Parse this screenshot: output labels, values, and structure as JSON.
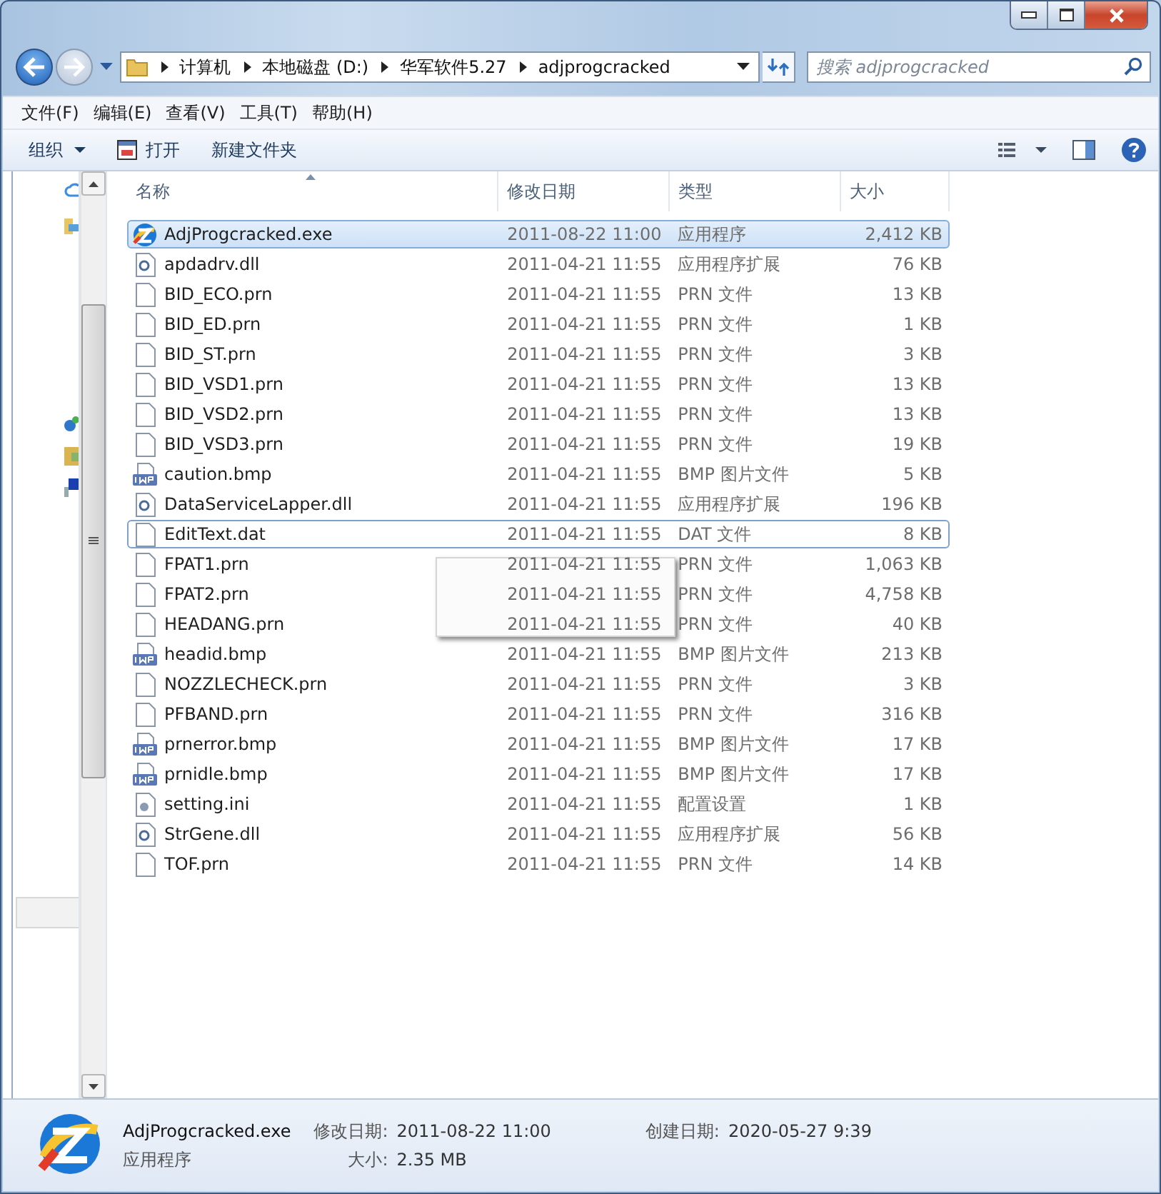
{
  "address": {
    "crumbs": [
      "计算机",
      "本地磁盘 (D:)",
      "华军软件5.27",
      "adjprogcracked"
    ]
  },
  "search": {
    "placeholder": "搜索 adjprogcracked"
  },
  "menu": [
    "文件(F)",
    "编辑(E)",
    "查看(V)",
    "工具(T)",
    "帮助(H)"
  ],
  "toolbar": [
    {
      "label": "组织",
      "kind": "dropdown"
    },
    {
      "label": "打开",
      "kind": "open"
    },
    {
      "label": "新建文件夹",
      "kind": "plain"
    }
  ],
  "columns": [
    "名称",
    "修改日期",
    "类型",
    "大小"
  ],
  "files": [
    {
      "name": "AdjProgcracked.exe",
      "date": "2011-08-22 11:00",
      "type": "应用程序",
      "size": "2,412 KB",
      "kind": "exe",
      "selected": true,
      "focused": false
    },
    {
      "name": "apdadrv.dll",
      "date": "2011-04-21 11:55",
      "type": "应用程序扩展",
      "size": "76 KB",
      "kind": "dll",
      "selected": false,
      "focused": false
    },
    {
      "name": "BID_ECO.prn",
      "date": "2011-04-21 11:55",
      "type": "PRN 文件",
      "size": "13 KB",
      "kind": "file",
      "selected": false,
      "focused": false
    },
    {
      "name": "BID_ED.prn",
      "date": "2011-04-21 11:55",
      "type": "PRN 文件",
      "size": "1 KB",
      "kind": "file",
      "selected": false,
      "focused": false
    },
    {
      "name": "BID_ST.prn",
      "date": "2011-04-21 11:55",
      "type": "PRN 文件",
      "size": "3 KB",
      "kind": "file",
      "selected": false,
      "focused": false
    },
    {
      "name": "BID_VSD1.prn",
      "date": "2011-04-21 11:55",
      "type": "PRN 文件",
      "size": "13 KB",
      "kind": "file",
      "selected": false,
      "focused": false
    },
    {
      "name": "BID_VSD2.prn",
      "date": "2011-04-21 11:55",
      "type": "PRN 文件",
      "size": "13 KB",
      "kind": "file",
      "selected": false,
      "focused": false
    },
    {
      "name": "BID_VSD3.prn",
      "date": "2011-04-21 11:55",
      "type": "PRN 文件",
      "size": "19 KB",
      "kind": "file",
      "selected": false,
      "focused": false
    },
    {
      "name": "caution.bmp",
      "date": "2011-04-21 11:55",
      "type": "BMP 图片文件",
      "size": "5 KB",
      "kind": "bmp",
      "selected": false,
      "focused": false
    },
    {
      "name": "DataServiceLapper.dll",
      "date": "2011-04-21 11:55",
      "type": "应用程序扩展",
      "size": "196 KB",
      "kind": "dll",
      "selected": false,
      "focused": false
    },
    {
      "name": "EditText.dat",
      "date": "2011-04-21 11:55",
      "type": "DAT 文件",
      "size": "8 KB",
      "kind": "file",
      "selected": false,
      "focused": true
    },
    {
      "name": "FPAT1.prn",
      "date": "2011-04-21 11:55",
      "type": "PRN 文件",
      "size": "1,063 KB",
      "kind": "file",
      "selected": false,
      "focused": false
    },
    {
      "name": "FPAT2.prn",
      "date": "2011-04-21 11:55",
      "type": "PRN 文件",
      "size": "4,758 KB",
      "kind": "file",
      "selected": false,
      "focused": false
    },
    {
      "name": "HEADANG.prn",
      "date": "2011-04-21 11:55",
      "type": "PRN 文件",
      "size": "40 KB",
      "kind": "file",
      "selected": false,
      "focused": false
    },
    {
      "name": "headid.bmp",
      "date": "2011-04-21 11:55",
      "type": "BMP 图片文件",
      "size": "213 KB",
      "kind": "bmp",
      "selected": false,
      "focused": false
    },
    {
      "name": "NOZZLECHECK.prn",
      "date": "2011-04-21 11:55",
      "type": "PRN 文件",
      "size": "3 KB",
      "kind": "file",
      "selected": false,
      "focused": false
    },
    {
      "name": "PFBAND.prn",
      "date": "2011-04-21 11:55",
      "type": "PRN 文件",
      "size": "316 KB",
      "kind": "file",
      "selected": false,
      "focused": false
    },
    {
      "name": "prnerror.bmp",
      "date": "2011-04-21 11:55",
      "type": "BMP 图片文件",
      "size": "17 KB",
      "kind": "bmp",
      "selected": false,
      "focused": false
    },
    {
      "name": "prnidle.bmp",
      "date": "2011-04-21 11:55",
      "type": "BMP 图片文件",
      "size": "17 KB",
      "kind": "bmp",
      "selected": false,
      "focused": false
    },
    {
      "name": "setting.ini",
      "date": "2011-04-21 11:55",
      "type": "配置设置",
      "size": "1 KB",
      "kind": "ini",
      "selected": false,
      "focused": false
    },
    {
      "name": "StrGene.dll",
      "date": "2011-04-21 11:55",
      "type": "应用程序扩展",
      "size": "56 KB",
      "kind": "dll",
      "selected": false,
      "focused": false
    },
    {
      "name": "TOF.prn",
      "date": "2011-04-21 11:55",
      "type": "PRN 文件",
      "size": "14 KB",
      "kind": "file",
      "selected": false,
      "focused": false
    }
  ],
  "details": {
    "name": "AdjProgcracked.exe",
    "type": "应用程序",
    "modified_label": "修改日期:",
    "modified": "2011-08-22 11:00",
    "created_label": "创建日期:",
    "created": "2020-05-27 9:39",
    "size_label": "大小:",
    "size": "2.35 MB"
  }
}
